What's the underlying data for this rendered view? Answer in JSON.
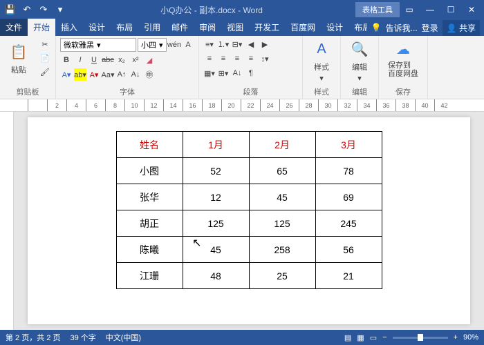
{
  "qat": {
    "save": "💾",
    "undo": "↶",
    "redo": "↷"
  },
  "title": "小Q办公 - 副本.docx - Word",
  "table_tools": "表格工具",
  "tabs": {
    "file": "文件",
    "home": "开始",
    "insert": "插入",
    "design": "设计",
    "layout": "布局",
    "ref": "引用",
    "mail": "邮件",
    "review": "审阅",
    "view": "视图",
    "dev": "开发工",
    "baidu": "百度网",
    "tt_design": "设计",
    "tt_layout": "布局"
  },
  "tell_me": "告诉我...",
  "login": "登录",
  "share": "共享",
  "ribbon": {
    "clipboard": {
      "label": "剪贴板",
      "paste": "粘贴"
    },
    "font": {
      "label": "字体",
      "name": "微软雅黑",
      "size": "小四",
      "pinyin": "wén",
      "bold": "B",
      "italic": "I",
      "underline": "U",
      "strike": "abc",
      "sub": "x₂",
      "sup": "x²"
    },
    "para": {
      "label": "段落"
    },
    "styles": {
      "label": "样式",
      "btn": "样式"
    },
    "edit": {
      "label": "编辑",
      "btn": "编辑"
    },
    "save": {
      "label": "保存",
      "btn": "保存到\n百度网盘"
    }
  },
  "ruler_marks": [
    " ",
    "2",
    "4",
    "6",
    "8",
    "10",
    "12",
    "14",
    "16",
    "18",
    "20",
    "22",
    "24",
    "26",
    "28",
    "30",
    "32",
    "34",
    "36",
    "38",
    "40",
    "42"
  ],
  "chart_data": {
    "type": "table",
    "headers": [
      "姓名",
      "1月",
      "2月",
      "3月"
    ],
    "rows": [
      [
        "小图",
        "52",
        "65",
        "78"
      ],
      [
        "张华",
        "12",
        "45",
        "69"
      ],
      [
        "胡正",
        "125",
        "125",
        "245"
      ],
      [
        "陈曦",
        "45",
        "258",
        "56"
      ],
      [
        "江珊",
        "48",
        "25",
        "21"
      ]
    ]
  },
  "status": {
    "page": "第 2 页，共 2 页",
    "words": "39 个字",
    "lang": "中文(中国)",
    "zoom": "90%"
  }
}
